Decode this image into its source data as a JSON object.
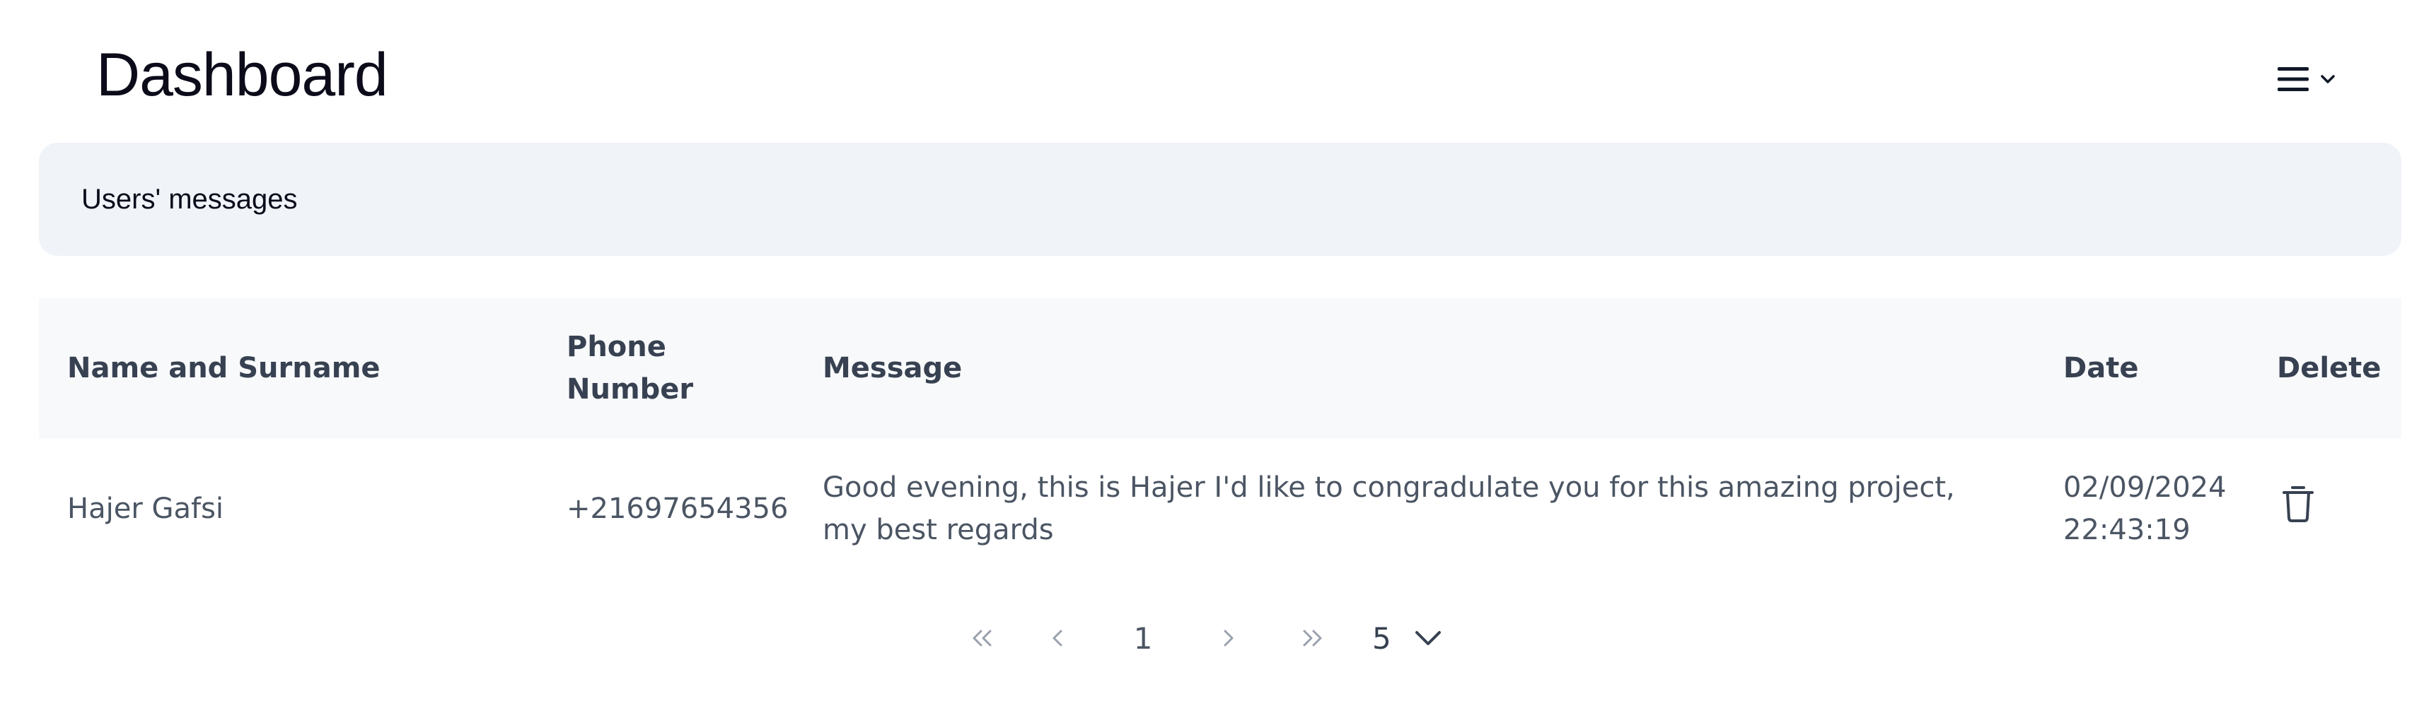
{
  "header": {
    "title": "Dashboard",
    "menu_icon": "hamburger-icon",
    "menu_chevron_icon": "chevron-down-icon"
  },
  "section": {
    "title": "Users' messages"
  },
  "table": {
    "columns": [
      "Name and Surname",
      "Phone Number",
      "Message",
      "Date",
      "Delete"
    ],
    "rows": [
      {
        "name": "Hajer Gafsi",
        "phone": "+21697654356",
        "message": "Good evening, this is Hajer I'd like to congradulate you for this amazing project, my best regards",
        "date": "02/09/2024 22:43:19",
        "delete_icon": "trash-icon"
      }
    ]
  },
  "pagination": {
    "current_page": "1",
    "page_size": "5",
    "first_icon": "double-chevron-left-icon",
    "prev_icon": "chevron-left-icon",
    "next_icon": "chevron-right-icon",
    "last_icon": "double-chevron-right-icon",
    "size_icon": "chevron-down-icon"
  },
  "colors": {
    "title_text": "#0b0b1a",
    "banner_bg": "#f0f3f8",
    "table_header_bg": "#f8f9fb",
    "body_text": "#4b5563",
    "muted_icon": "#9aa1ad"
  }
}
